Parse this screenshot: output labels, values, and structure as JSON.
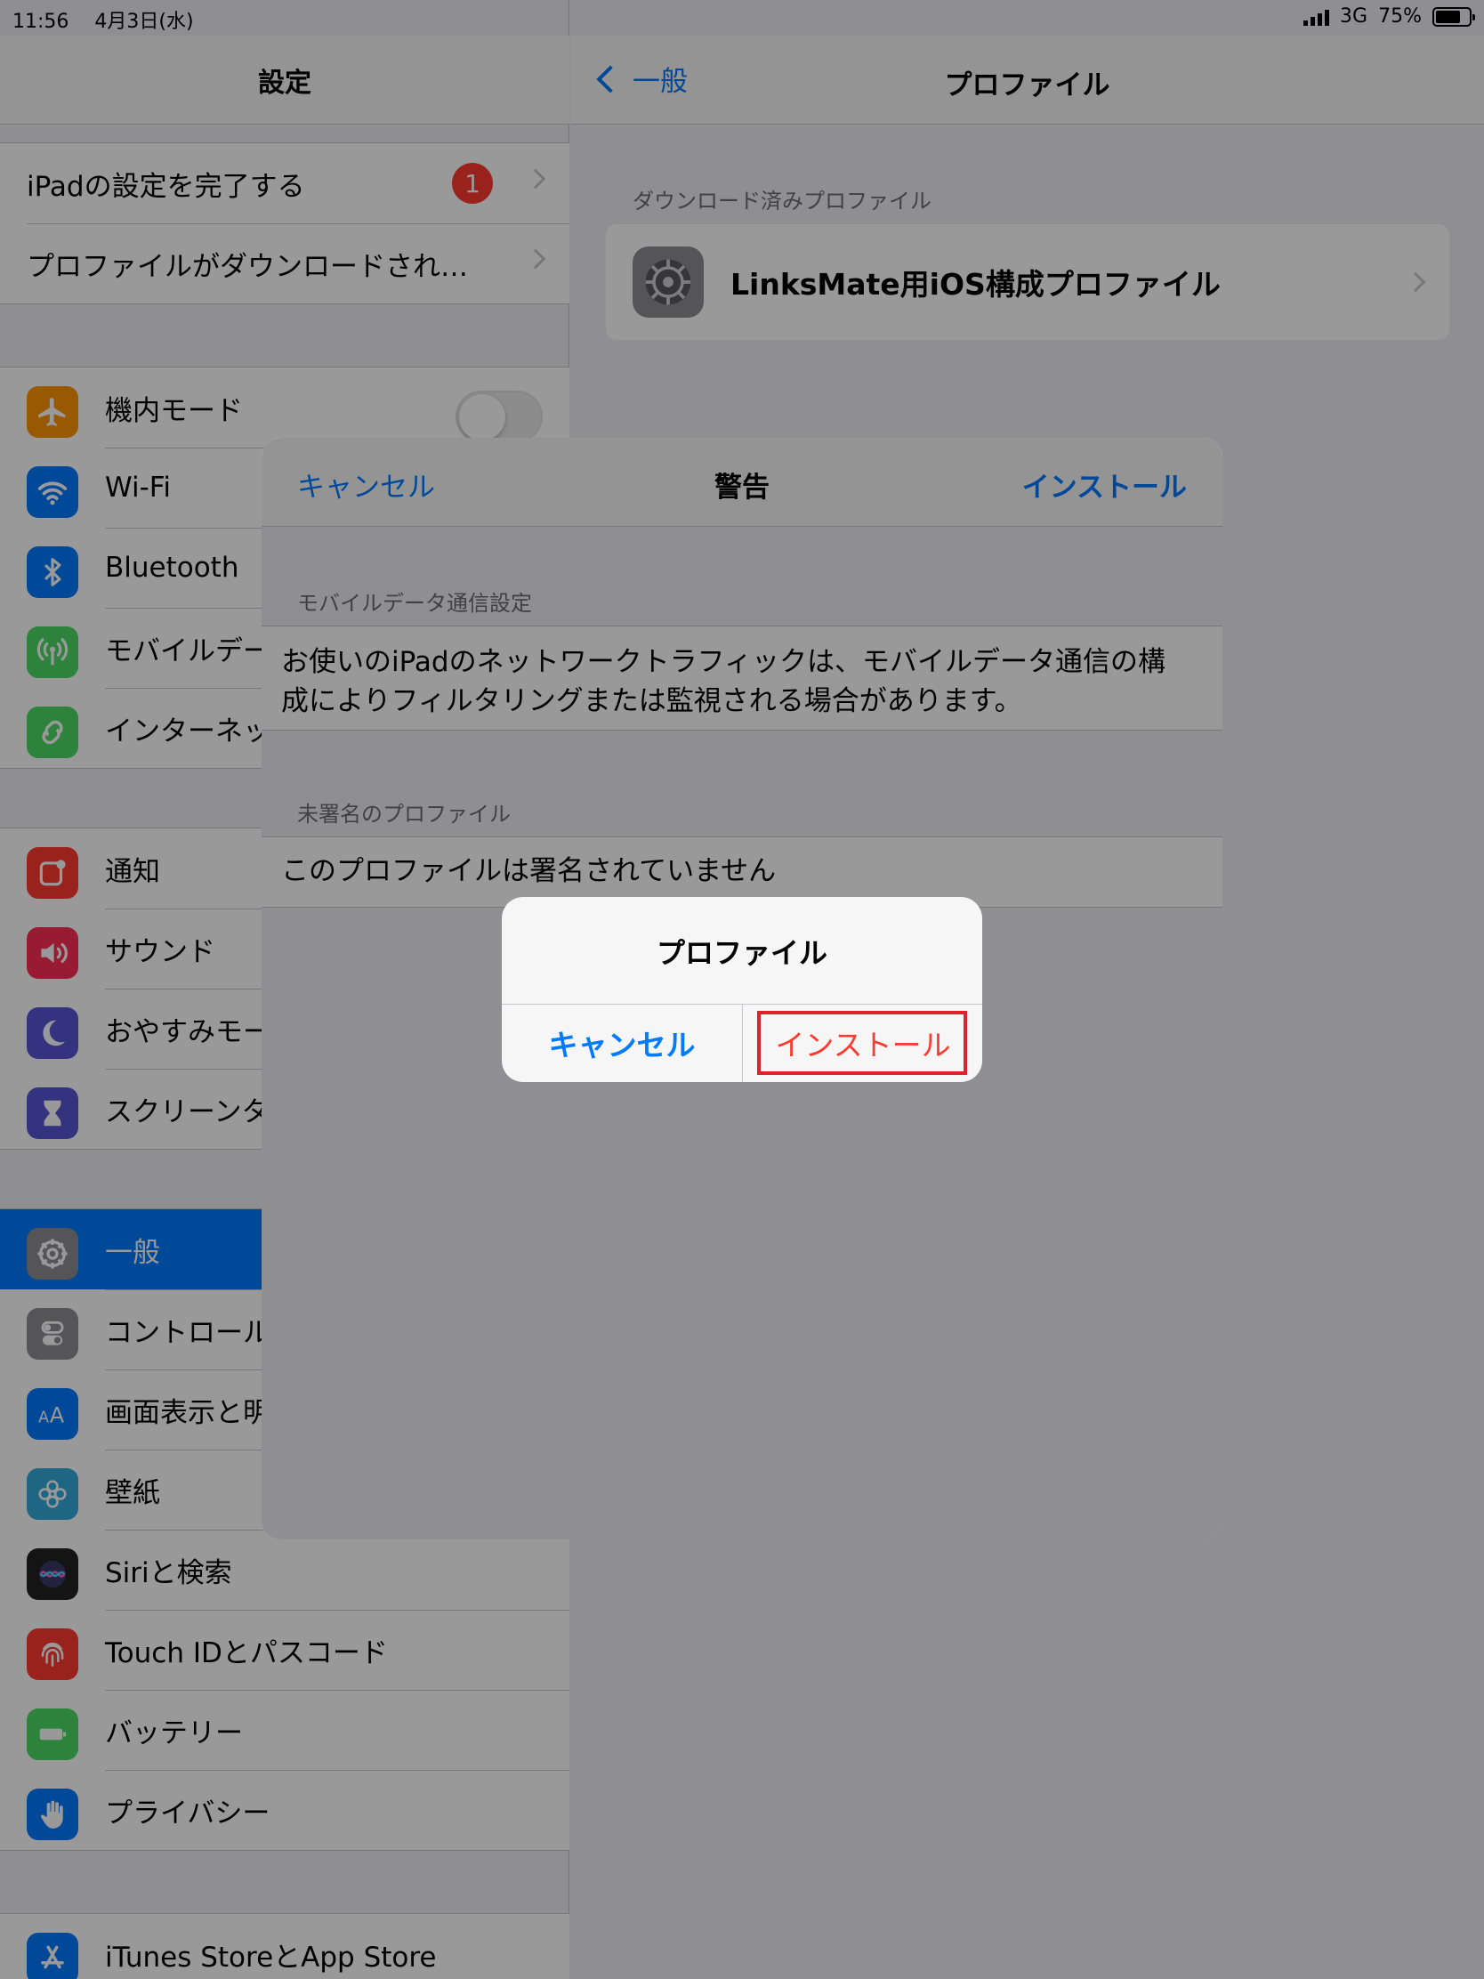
{
  "status": {
    "time": "11:56",
    "date": "4月3日(水)",
    "network": "3G",
    "battery": "75%",
    "battery_level": 0.75
  },
  "left": {
    "title": "設定",
    "top_items": [
      {
        "label": "iPadの設定を完了する",
        "badge": "1"
      },
      {
        "label": "プロファイルがダウンロードされ…"
      }
    ],
    "group1": [
      {
        "label": "機内モード",
        "icon": "airplane-icon",
        "color": "#ff9500"
      },
      {
        "label": "Wi-Fi",
        "icon": "wifi-icon",
        "color": "#007aff"
      },
      {
        "label": "Bluetooth",
        "icon": "bluetooth-icon",
        "color": "#007aff"
      },
      {
        "label": "モバイルデー",
        "icon": "antenna-icon",
        "color": "#4cd964"
      },
      {
        "label": "インターネッ",
        "icon": "chain-icon",
        "color": "#4cd964"
      }
    ],
    "group2": [
      {
        "label": "通知",
        "icon": "notifications-icon",
        "color": "#ff3b30"
      },
      {
        "label": "サウンド",
        "icon": "speaker-icon",
        "color": "#ff2d55"
      },
      {
        "label": "おやすみモー",
        "icon": "moon-icon",
        "color": "#5856d6"
      },
      {
        "label": "スクリーンタ",
        "icon": "hourglass-icon",
        "color": "#5856d6"
      }
    ],
    "group3": [
      {
        "label": "一般",
        "icon": "gear-icon",
        "color": "#8e8e93"
      },
      {
        "label": "コントロール",
        "icon": "switches-icon",
        "color": "#8e8e93"
      },
      {
        "label": "画面表示と明",
        "icon": "text-size-icon",
        "color": "#007aff"
      },
      {
        "label": "壁紙",
        "icon": "flower-icon",
        "color": "#34aadc"
      },
      {
        "label": "Siriと検索",
        "icon": "siri-icon",
        "color": "#222"
      },
      {
        "label": "Touch IDとパスコード",
        "icon": "fingerprint-icon",
        "color": "#ff3b30"
      },
      {
        "label": "バッテリー",
        "icon": "battery-icon",
        "color": "#4cd964"
      },
      {
        "label": "プライバシー",
        "icon": "hand-icon",
        "color": "#007aff"
      }
    ],
    "group4": [
      {
        "label": "iTunes StoreとApp Store",
        "icon": "appstore-icon",
        "color": "#007aff"
      }
    ]
  },
  "right": {
    "back_label": "一般",
    "title": "プロファイル",
    "section_header": "ダウンロード済みプロファイル",
    "profile_name": "LinksMate用iOS構成プロファイル"
  },
  "sheet": {
    "cancel_label": "キャンセル",
    "title": "警告",
    "install_label": "インストール",
    "section1_header": "モバイルデータ通信設定",
    "section1_text": "お使いのiPadのネットワークトラフィックは、モバイルデータ通信の構成によりフィルタリングまたは監視される場合があります。",
    "section2_header": "未署名のプロファイル",
    "section2_text": "このプロファイルは署名されていません"
  },
  "alert": {
    "title": "プロファイル",
    "cancel_label": "キャンセル",
    "install_label": "インストール"
  }
}
